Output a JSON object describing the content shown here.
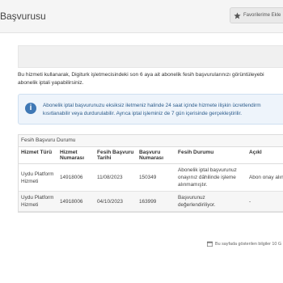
{
  "header": {
    "title": "Başvurusu",
    "favorite_label": "Favorilerime Ekle"
  },
  "intro": {
    "line1": "Bu hizmeti kullanarak, Digiturk işletmecisindeki son 6 aya ait abonelik fesih başvurularınızı görüntüleyebi",
    "line2": "abonelik iptali yapabilirsiniz."
  },
  "info": {
    "line1": "Abonelik iptal başvurunuzu eksiksiz iletmeniz halinde 24 saat içinde hizmete ilişkin ücretlendirm",
    "line2": "kısıtlanabilir veya durdurulabilir. Ayrıca iptal işleminiz de 7 gün içerisinde gerçekleştirilir."
  },
  "table": {
    "caption": "Fesih Başvuru Durumu",
    "headers": [
      "Hizmet Türü",
      "Hizmet Numarası",
      "Fesih Başvuru Tarihi",
      "Başvuru Numarası",
      "Fesih Durumu",
      "Açıkl"
    ],
    "rows": [
      [
        "Uydu Platform Hizmeti",
        "14918006",
        "11/08/2023",
        "150349",
        "Abonelik iptal başvurunuz onayınız dâhilinde işleme alınmamıştır.",
        "Abon onay alınn"
      ],
      [
        "Uydu Platform Hizmeti",
        "14918006",
        "04/10/2023",
        "163999",
        "Başvurunuz değerlendiriliyor.",
        "-"
      ]
    ]
  },
  "footer": {
    "note": "Bu sayfada gösterilen bilgiler 10 G"
  },
  "colors": {
    "info_accent": "#3f78b5",
    "info_bg": "#eef4fb"
  }
}
